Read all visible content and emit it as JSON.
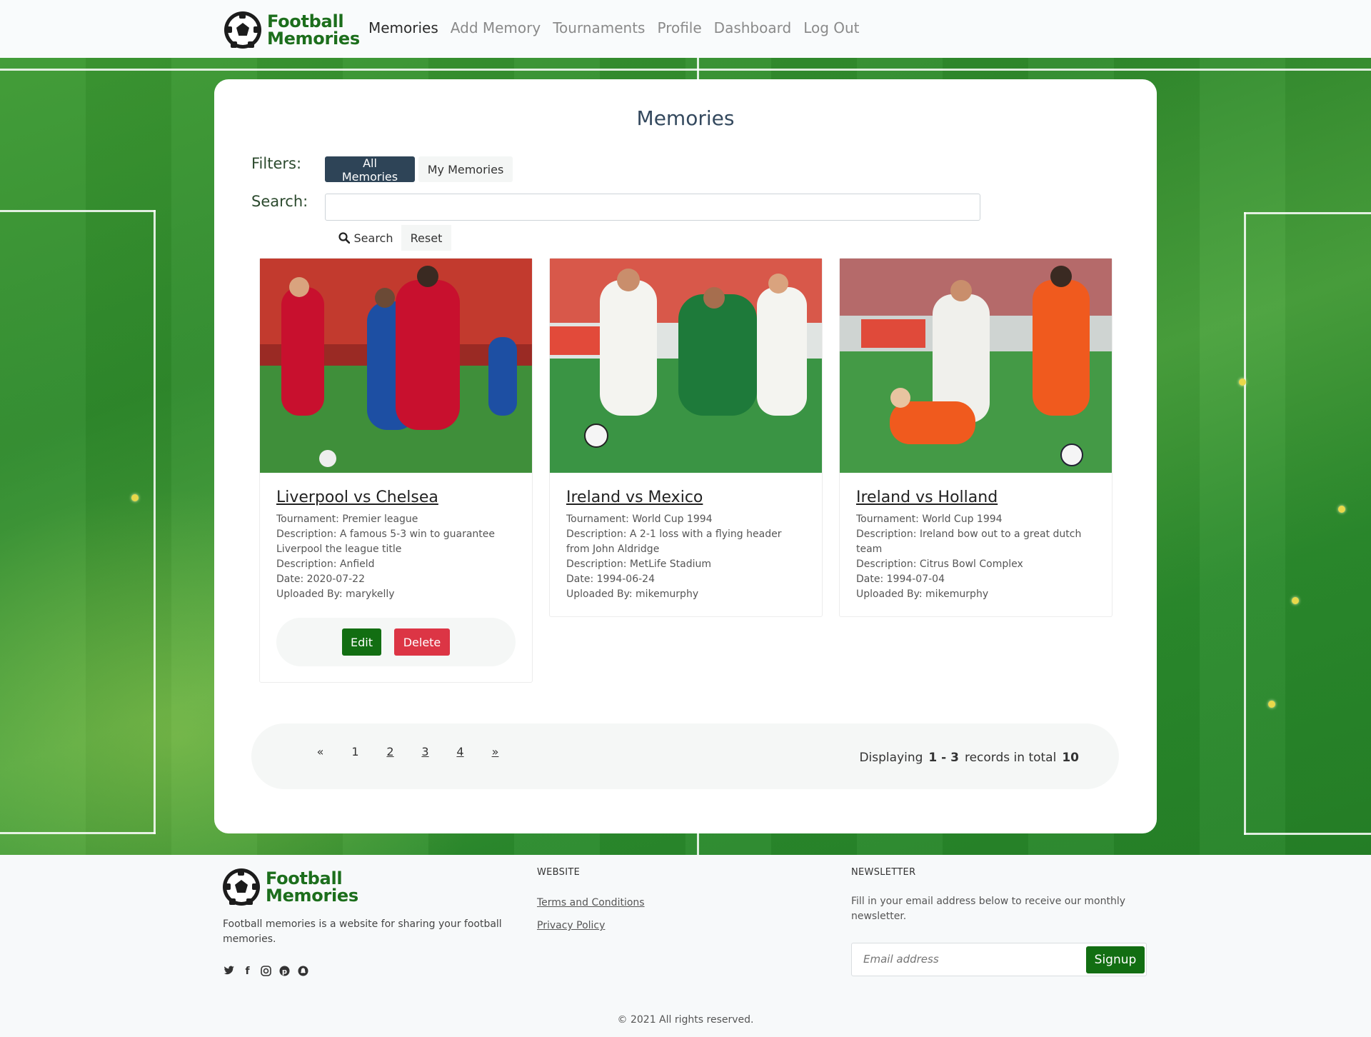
{
  "brand": {
    "line1": "Football",
    "line2": "Memories"
  },
  "nav": [
    {
      "label": "Memories",
      "active": true
    },
    {
      "label": "Add Memory"
    },
    {
      "label": "Tournaments"
    },
    {
      "label": "Profile"
    },
    {
      "label": "Dashboard"
    },
    {
      "label": "Log Out"
    }
  ],
  "page": {
    "title": "Memories",
    "filters_label": "Filters:",
    "filter_all": "All Memories",
    "filter_my": "My Memories",
    "search_label": "Search:",
    "search_value": "",
    "search_button": "Search",
    "reset_button": "Reset"
  },
  "cards": [
    {
      "title": "Liverpool vs Chelsea",
      "tournament": "Tournament: Premier league",
      "description": "Description: A famous 5-3 win to guarantee Liverpool the league title",
      "venue": "Description: Anfield",
      "date": "Date: 2020-07-22",
      "uploaded": "Uploaded By: marykelly",
      "edit": "Edit",
      "delete": "Delete",
      "colors": {
        "sky": "#c23a2e",
        "shirt1": "#c8102e",
        "shirt2": "#1d4fa3",
        "pitch": "#3f8f3a"
      }
    },
    {
      "title": "Ireland vs Mexico",
      "tournament": "Tournament: World Cup 1994",
      "description": "Description: A 2-1 loss with a flying header from John Aldridge",
      "venue": "Description: MetLife Stadium",
      "date": "Date: 1994-06-24",
      "uploaded": "Uploaded By: mikemurphy",
      "colors": {
        "sky": "#d8584a",
        "shirt1": "#f4f4f0",
        "shirt2": "#1e7a3a",
        "pitch": "#3a9444"
      }
    },
    {
      "title": "Ireland vs Holland",
      "tournament": "Tournament: World Cup 1994",
      "description": "Description: Ireland bow out to a great dutch team",
      "venue": "Description: Citrus Bowl Complex",
      "date": "Date: 1994-07-04",
      "uploaded": "Uploaded By: mikemurphy",
      "colors": {
        "sky": "#b56a6a",
        "shirt1": "#f0f0ec",
        "shirt2": "#f05a1e",
        "pitch": "#449a46"
      }
    }
  ],
  "pagination": {
    "prev": "«",
    "pages": [
      "1",
      "2",
      "3",
      "4"
    ],
    "next": "»",
    "displaying": "Displaying",
    "range": "1 - 3",
    "records_in_total": "records in total",
    "total": "10"
  },
  "footer": {
    "description": "Football memories is a website for sharing your football memories.",
    "social_icons": [
      "twitter-icon",
      "facebook-icon",
      "instagram-icon",
      "pinterest-icon",
      "snapchat-icon"
    ],
    "website_heading": "WEBSITE",
    "terms": "Terms and Conditions",
    "privacy": "Privacy Policy",
    "newsletter_heading": "NEWSLETTER",
    "newsletter_text": "Fill in your email address below to receive our monthly newsletter.",
    "email_placeholder": "Email address",
    "signup": "Signup",
    "copyright": "© 2021 All rights reserved."
  },
  "colors": {
    "brand_green": "#1c6e1c",
    "filter_active": "#2e4457",
    "delete": "#dc3545"
  }
}
